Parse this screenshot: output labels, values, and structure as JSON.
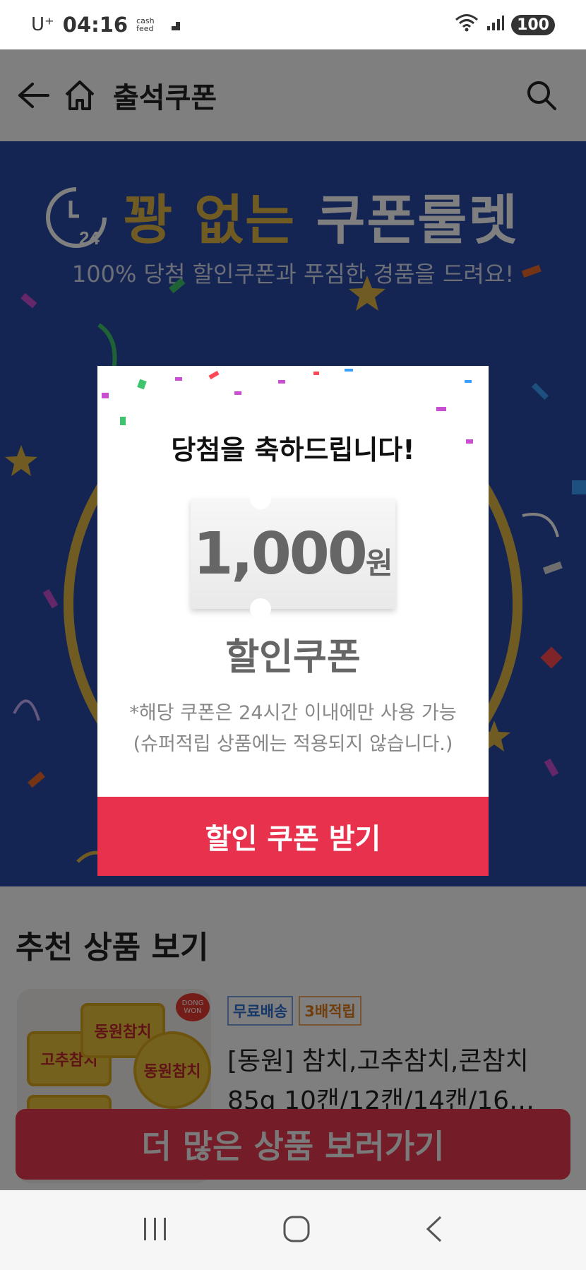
{
  "status_bar": {
    "carrier": "U⁺",
    "time": "04:16",
    "cashfeed_line1": "cash",
    "cashfeed_line2": "feed",
    "battery": "100"
  },
  "header": {
    "title": "출석쿠폰",
    "icons": [
      "back-arrow-icon",
      "home-icon",
      "search-icon"
    ]
  },
  "banner": {
    "clock_label": "L 24",
    "title_gold": "꽝 없는",
    "title_white": "쿠폰룰렛",
    "subtitle": "100% 당첨 할인쿠폰과 푸짐한 경품을 드려요!"
  },
  "modal": {
    "title": "당첨을 축하드립니다!",
    "coupon_amount": "1,000",
    "coupon_unit": "원",
    "coupon_label": "할인쿠폰",
    "note_line1": "*해당 쿠폰은 24시간 이내에만 사용 가능",
    "note_line2": "(슈퍼적립 상품에는 적용되지 않습니다.)",
    "button_label": "할인 쿠폰 받기"
  },
  "recommend": {
    "section_title": "추천 상품 보기",
    "product": {
      "badge1": "무료배송",
      "badge2": "3배적립",
      "name_line1": "[동원] 참치,고추참치,콘참치",
      "name_line2": "85g 10캔/12캔/14캔/16…",
      "image_text_1": "동원참치",
      "image_text_2": "고추참치",
      "image_text_3": "DONG WON"
    },
    "more_button": "더 많은 상품 보러가기"
  },
  "colors": {
    "banner_blue": "#2a4aa6",
    "gold": "#e0b744",
    "red_button": "#e8324d"
  }
}
